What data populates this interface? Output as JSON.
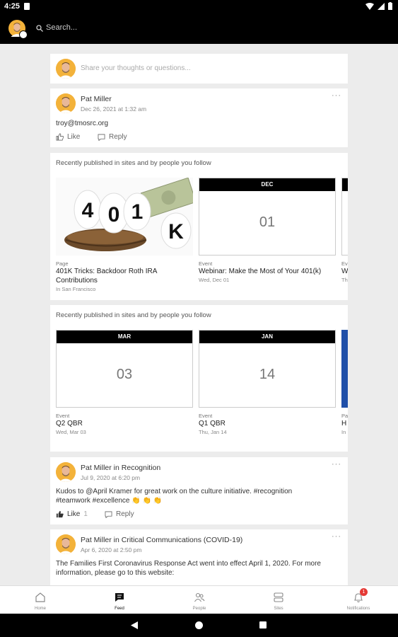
{
  "status": {
    "time": "4:25"
  },
  "header": {
    "search_placeholder": "Search..."
  },
  "compose": {
    "placeholder": "Share your thoughts or questions..."
  },
  "posts": [
    {
      "author": "Pat Miller",
      "date": "Dec 26, 2021 at 1:32 am",
      "text": "troy@tmosrc.org",
      "like": "Like",
      "like_count": "",
      "reply": "Reply"
    },
    {
      "author": "Pat Miller in Recognition",
      "date": "Jul 9, 2020 at 6:20 pm",
      "text": "Kudos to @April Kramer for great work on the culture initiative. #recognition #teamwork #excellence 👏 👏 👏",
      "like": "Like",
      "like_count": "1",
      "reply": "Reply"
    },
    {
      "author": "Pat Miller in Critical Communications (COVID-19)",
      "date": "Apr 6, 2020 at 2:50 pm",
      "text": "The Families First Coronavirus Response Act went into effect April 1, 2020. For more information, please go to this website:"
    }
  ],
  "sections": [
    {
      "title": "Recently published in sites and by people you follow",
      "tiles": [
        {
          "kind": "image",
          "image_text": "401K",
          "type": "Page",
          "title": "401K Tricks: Backdoor Roth IRA Contributions",
          "meta": "In San Francisco"
        },
        {
          "kind": "calendar",
          "month": "DEC",
          "day": "01",
          "type": "Event",
          "title": "Webinar: Make the Most of Your 401(k)",
          "meta": "Wed, Dec 01"
        },
        {
          "kind": "calendar",
          "month": "",
          "day": "",
          "type": "Ev",
          "title": "W 40",
          "meta": "Th"
        }
      ]
    },
    {
      "title": "Recently published in sites and by people you follow",
      "tiles": [
        {
          "kind": "calendar",
          "month": "MAR",
          "day": "03",
          "type": "Event",
          "title": "Q2 QBR",
          "meta": "Wed, Mar 03"
        },
        {
          "kind": "calendar",
          "month": "JAN",
          "day": "14",
          "type": "Event",
          "title": "Q1 QBR",
          "meta": "Thu, Jan 14"
        },
        {
          "kind": "blue",
          "type": "Pa",
          "title": "H A",
          "meta": "In"
        }
      ]
    }
  ],
  "nav": [
    {
      "label": "Home",
      "icon": "home-icon"
    },
    {
      "label": "Feed",
      "icon": "feed-icon",
      "active": true
    },
    {
      "label": "People",
      "icon": "people-icon"
    },
    {
      "label": "Sites",
      "icon": "sites-icon"
    },
    {
      "label": "Notifications",
      "icon": "bell-icon",
      "badge": "1"
    }
  ],
  "colors": {
    "accent": "#f3b23a",
    "badge": "#e53935",
    "calendar_header": "#000000",
    "blue_tile": "#1f4fa8"
  }
}
